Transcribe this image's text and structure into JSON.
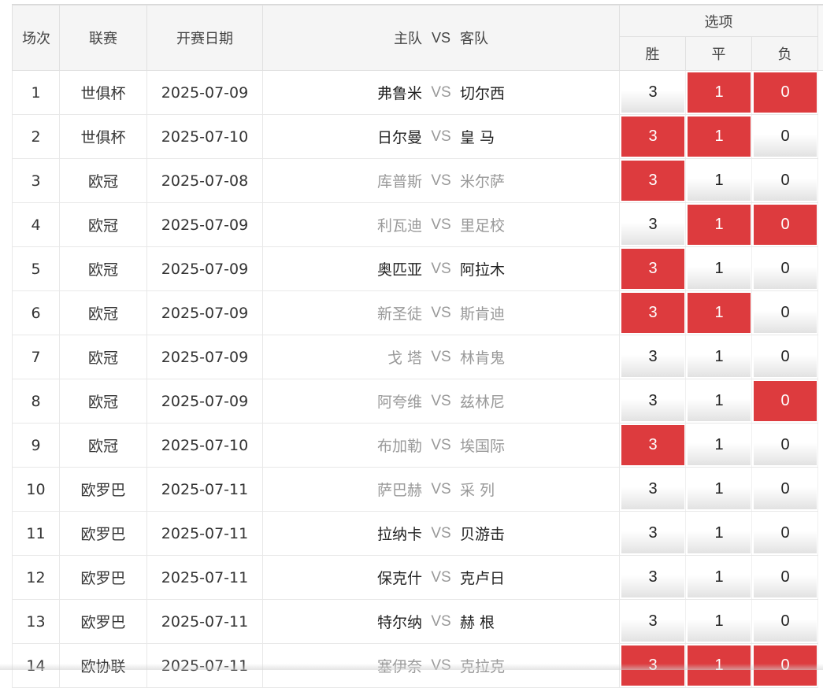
{
  "header": {
    "index_label": "场次",
    "league_label": "联赛",
    "date_label": "开赛日期",
    "home_label": "主队",
    "vs_label": "VS",
    "away_label": "客队",
    "options_label": "选项",
    "win_label": "胜",
    "draw_label": "平",
    "loss_label": "负"
  },
  "colors": {
    "selected": "#dd3b3e",
    "header_bg": "#f5f5f5",
    "muted_team": "#999999"
  },
  "matches": [
    {
      "index": "1",
      "league": "世俱杯",
      "date": "2025-07-09",
      "home": "弗鲁米",
      "vs": "VS",
      "away": "切尔西",
      "home_style": "strong",
      "away_style": "strong",
      "options": [
        {
          "label": "3",
          "selected": false
        },
        {
          "label": "1",
          "selected": true
        },
        {
          "label": "0",
          "selected": true
        }
      ]
    },
    {
      "index": "2",
      "league": "世俱杯",
      "date": "2025-07-10",
      "home": "日尔曼",
      "vs": "VS",
      "away": "皇 马",
      "home_style": "strong",
      "away_style": "strong",
      "options": [
        {
          "label": "3",
          "selected": true
        },
        {
          "label": "1",
          "selected": true
        },
        {
          "label": "0",
          "selected": false
        }
      ]
    },
    {
      "index": "3",
      "league": "欧冠",
      "date": "2025-07-08",
      "home": "库普斯",
      "vs": "VS",
      "away": "米尔萨",
      "home_style": "muted",
      "away_style": "muted",
      "options": [
        {
          "label": "3",
          "selected": true
        },
        {
          "label": "1",
          "selected": false
        },
        {
          "label": "0",
          "selected": false
        }
      ]
    },
    {
      "index": "4",
      "league": "欧冠",
      "date": "2025-07-09",
      "home": "利瓦迪",
      "vs": "VS",
      "away": "里足校",
      "home_style": "muted",
      "away_style": "muted",
      "options": [
        {
          "label": "3",
          "selected": false
        },
        {
          "label": "1",
          "selected": true
        },
        {
          "label": "0",
          "selected": true
        }
      ]
    },
    {
      "index": "5",
      "league": "欧冠",
      "date": "2025-07-09",
      "home": "奥匹亚",
      "vs": "VS",
      "away": "阿拉木",
      "home_style": "strong",
      "away_style": "strong",
      "options": [
        {
          "label": "3",
          "selected": true
        },
        {
          "label": "1",
          "selected": false
        },
        {
          "label": "0",
          "selected": false
        }
      ]
    },
    {
      "index": "6",
      "league": "欧冠",
      "date": "2025-07-09",
      "home": "新圣徒",
      "vs": "VS",
      "away": "斯肯迪",
      "home_style": "muted",
      "away_style": "muted",
      "options": [
        {
          "label": "3",
          "selected": true
        },
        {
          "label": "1",
          "selected": true
        },
        {
          "label": "0",
          "selected": false
        }
      ]
    },
    {
      "index": "7",
      "league": "欧冠",
      "date": "2025-07-09",
      "home": "戈 塔",
      "vs": "VS",
      "away": "林肯鬼",
      "home_style": "muted",
      "away_style": "muted",
      "options": [
        {
          "label": "3",
          "selected": false
        },
        {
          "label": "1",
          "selected": false
        },
        {
          "label": "0",
          "selected": false
        }
      ]
    },
    {
      "index": "8",
      "league": "欧冠",
      "date": "2025-07-09",
      "home": "阿夸维",
      "vs": "VS",
      "away": "兹林尼",
      "home_style": "muted",
      "away_style": "muted",
      "options": [
        {
          "label": "3",
          "selected": false
        },
        {
          "label": "1",
          "selected": false
        },
        {
          "label": "0",
          "selected": true
        }
      ]
    },
    {
      "index": "9",
      "league": "欧冠",
      "date": "2025-07-10",
      "home": "布加勒",
      "vs": "VS",
      "away": "埃国际",
      "home_style": "muted",
      "away_style": "muted",
      "options": [
        {
          "label": "3",
          "selected": true
        },
        {
          "label": "1",
          "selected": false
        },
        {
          "label": "0",
          "selected": false
        }
      ]
    },
    {
      "index": "10",
      "league": "欧罗巴",
      "date": "2025-07-11",
      "home": "萨巴赫",
      "vs": "VS",
      "away": "采 列",
      "home_style": "muted",
      "away_style": "muted",
      "options": [
        {
          "label": "3",
          "selected": false
        },
        {
          "label": "1",
          "selected": false
        },
        {
          "label": "0",
          "selected": false
        }
      ]
    },
    {
      "index": "11",
      "league": "欧罗巴",
      "date": "2025-07-11",
      "home": "拉纳卡",
      "vs": "VS",
      "away": "贝游击",
      "home_style": "strong",
      "away_style": "strong",
      "options": [
        {
          "label": "3",
          "selected": false
        },
        {
          "label": "1",
          "selected": false
        },
        {
          "label": "0",
          "selected": false
        }
      ]
    },
    {
      "index": "12",
      "league": "欧罗巴",
      "date": "2025-07-11",
      "home": "保克什",
      "vs": "VS",
      "away": "克卢日",
      "home_style": "strong",
      "away_style": "strong",
      "options": [
        {
          "label": "3",
          "selected": false
        },
        {
          "label": "1",
          "selected": false
        },
        {
          "label": "0",
          "selected": false
        }
      ]
    },
    {
      "index": "13",
      "league": "欧罗巴",
      "date": "2025-07-11",
      "home": "特尔纳",
      "vs": "VS",
      "away": "赫 根",
      "home_style": "strong",
      "away_style": "strong",
      "options": [
        {
          "label": "3",
          "selected": false
        },
        {
          "label": "1",
          "selected": false
        },
        {
          "label": "0",
          "selected": false
        }
      ]
    },
    {
      "index": "14",
      "league": "欧协联",
      "date": "2025-07-11",
      "home": "塞伊奈",
      "vs": "VS",
      "away": "克拉克",
      "home_style": "muted",
      "away_style": "muted",
      "options": [
        {
          "label": "3",
          "selected": true
        },
        {
          "label": "1",
          "selected": true
        },
        {
          "label": "0",
          "selected": true
        }
      ]
    }
  ]
}
